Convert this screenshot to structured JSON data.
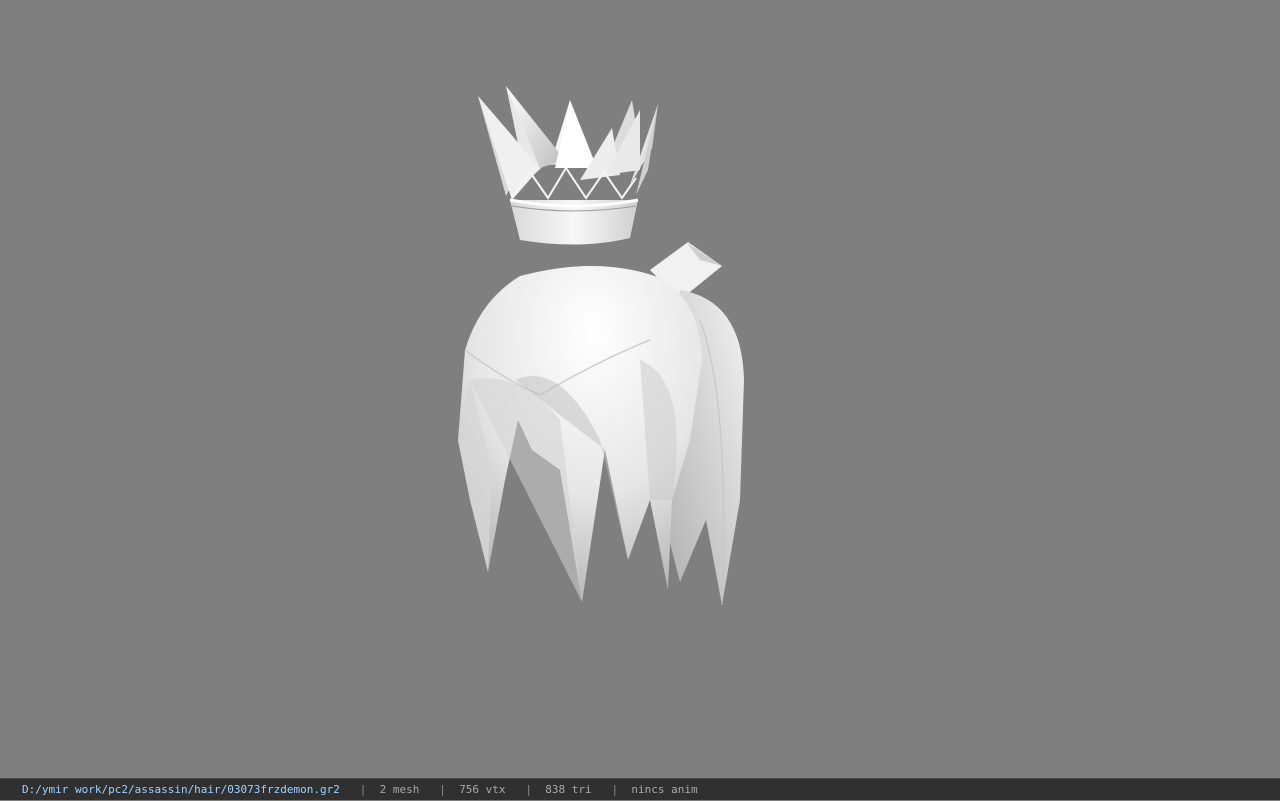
{
  "viewport": {
    "background": "#7f7f7f",
    "model": "hair-with-crown",
    "shading": "gouraud-white"
  },
  "statusbar": {
    "path": "D:/ymir work/pc2/assassin/hair/03073frzdemon.gr2",
    "separator": "|",
    "mesh": "2 mesh",
    "vtx": "756 vtx",
    "tri": "838 tri",
    "anim": "nincs anim",
    "path_color": "#9fd0ff",
    "text_color": "#a8a8a8"
  }
}
